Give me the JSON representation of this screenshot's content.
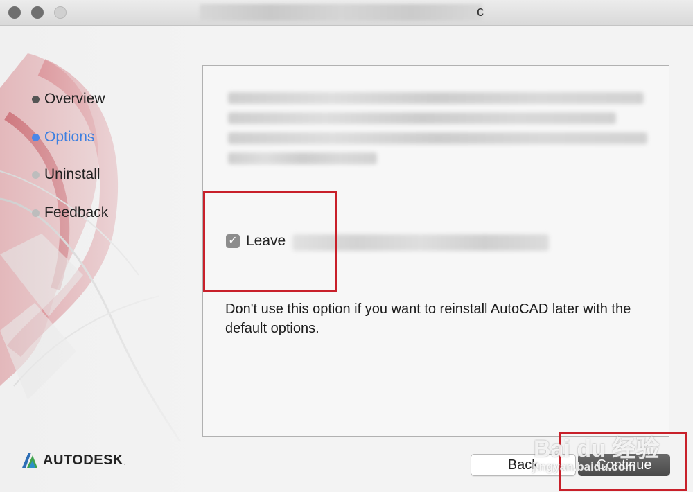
{
  "window": {
    "title_tail": "c"
  },
  "steps": [
    {
      "label": "Overview",
      "state": "done"
    },
    {
      "label": "Options",
      "state": "active"
    },
    {
      "label": "Uninstall",
      "state": "pending"
    },
    {
      "label": "Feedback",
      "state": "pending"
    }
  ],
  "brand": {
    "name": "AUTODESK",
    "registered": "."
  },
  "options": {
    "checkbox_label": "Leave",
    "checkbox_checked": true,
    "note": "Don't use this option if you want to reinstall AutoCAD later with the default options."
  },
  "buttons": {
    "back": "Back",
    "continue": "Continue"
  },
  "watermark": {
    "main": "Bai du 经验",
    "sub": "jingyan.baidu.com"
  },
  "colors": {
    "active_step": "#3d7fe0",
    "highlight_box": "#c8202a",
    "brand_logo": "#2d6db5"
  },
  "icons": [
    "close-icon",
    "minimize-icon",
    "zoom-icon",
    "checkmark-icon",
    "autodesk-logo-icon"
  ]
}
